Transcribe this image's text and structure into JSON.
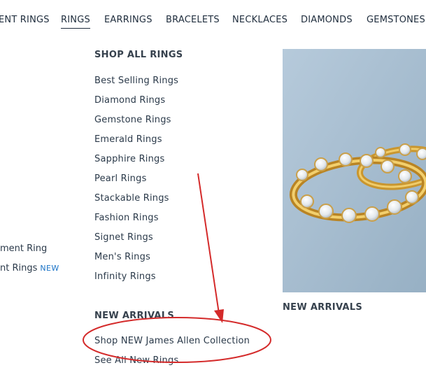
{
  "nav": {
    "items": [
      {
        "label": "ENT RINGS"
      },
      {
        "label": "RINGS"
      },
      {
        "label": "EARRINGS"
      },
      {
        "label": "BRACELETS"
      },
      {
        "label": "NECKLACES"
      },
      {
        "label": "DIAMONDS"
      },
      {
        "label": "GEMSTONES"
      }
    ]
  },
  "left_column": {
    "items": [
      {
        "label": "ment Ring"
      },
      {
        "label": "nt Rings",
        "badge": "NEW"
      }
    ]
  },
  "shop_all": {
    "heading": "SHOP ALL RINGS",
    "links": [
      "Best Selling Rings",
      "Diamond Rings",
      "Gemstone Rings",
      "Emerald Rings",
      "Sapphire Rings",
      "Pearl Rings",
      "Stackable Rings",
      "Fashion Rings",
      "Signet Rings",
      "Men's Rings",
      "Infinity Rings"
    ]
  },
  "new_arrivals": {
    "heading": "NEW ARRIVALS",
    "links": [
      "Shop NEW James Allen Collection",
      "See All New Rings"
    ]
  },
  "promo": {
    "image_desc": "gold-diamond-hoop-earrings",
    "label": "NEW ARRIVALS"
  },
  "annotation": {
    "color": "#d42a2a"
  }
}
